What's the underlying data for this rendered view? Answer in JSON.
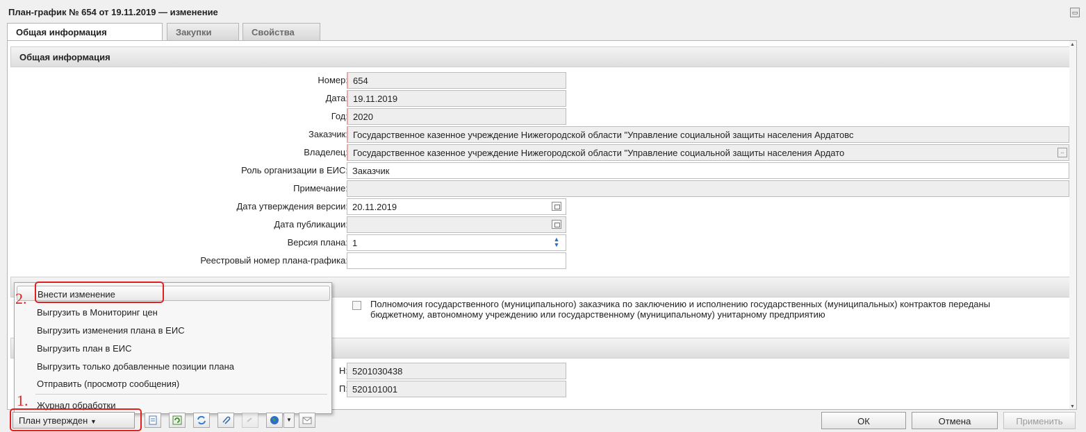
{
  "window": {
    "title": "План-график № 654 от 19.11.2019 — изменение"
  },
  "tabs": [
    {
      "label": "Общая информация",
      "active": true
    },
    {
      "label": "Закупки",
      "active": false
    },
    {
      "label": "Свойства",
      "active": false
    }
  ],
  "section_general": {
    "header": "Общая информация",
    "fields": {
      "number": {
        "label": "Номер:",
        "value": "654"
      },
      "date": {
        "label": "Дата:",
        "value": "19.11.2019"
      },
      "year": {
        "label": "Год:",
        "value": "2020"
      },
      "customer": {
        "label": "Заказчик:",
        "value": "Государственное казенное учреждение Нижегородской области \"Управление социальной защиты населения Ардатовс"
      },
      "owner": {
        "label": "Владелец:",
        "value": "Государственное казенное учреждение Нижегородской области \"Управление социальной защиты населения Ардато"
      },
      "role": {
        "label": "Роль организации в ЕИС:",
        "value": "Заказчик"
      },
      "note": {
        "label": "Примечание:",
        "value": ""
      },
      "approval_date": {
        "label": "Дата утверждения версии:",
        "value": "20.11.2019"
      },
      "publish_date": {
        "label": "Дата публикации:",
        "value": ""
      },
      "plan_version": {
        "label": "Версия плана:",
        "value": "1"
      },
      "registry_number": {
        "label": "Реестровый номер плана-графика:",
        "value": ""
      }
    }
  },
  "section_powers": {
    "checkbox_text": "Полномочия государственного (муниципального) заказчика по заключению и исполнению государственных (муниципальных) контрактов переданы бюджетному, автономному учреждению или государственному (муниципальному) унитарному предприятию"
  },
  "section_org": {
    "inn": {
      "label_tail": "Н:",
      "value": "5201030438"
    },
    "kpp": {
      "label_tail": "П:",
      "value": "520101001"
    }
  },
  "context_menu": {
    "items": [
      "Внести изменение",
      "Выгрузить в Мониторинг цен",
      "Выгрузить изменения плана в ЕИС",
      "Выгрузить план в ЕИС",
      "Выгрузить только добавленные позиции плана",
      "Отправить (просмотр сообщения)",
      "Журнал обработки"
    ]
  },
  "annotations": {
    "step1": "1.",
    "step2": "2."
  },
  "bottombar": {
    "status_button": "План утвержден",
    "ok": "ОК",
    "cancel": "Отмена",
    "apply": "Применить"
  },
  "colors": {
    "annotation": "#e02020",
    "required_marker": "#e9a8a8"
  }
}
